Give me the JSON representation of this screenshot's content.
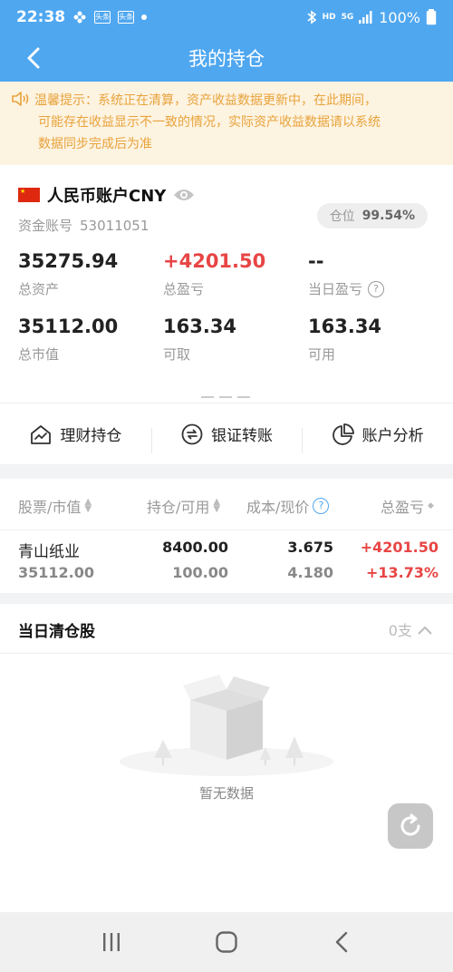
{
  "status": {
    "time": "22:38",
    "net_label": "HD",
    "signal_label": "5G",
    "battery": "100%",
    "chip1": "头条",
    "chip2": "头条"
  },
  "nav": {
    "title": "我的持仓"
  },
  "notice": {
    "line1": "温馨提示：系统正在清算，资产收益数据更新中，在此期间，",
    "line2": "可能存在收益显示不一致的情况，实际资产收益数据请以系统",
    "line3": "数据同步完成后为准"
  },
  "account": {
    "name": "人民币账户CNY",
    "id_label": "资金账号",
    "id_value": "53011051",
    "position_label": "仓位",
    "position_value": "99.54%",
    "total_assets": "35275.94",
    "total_assets_label": "总资产",
    "total_pnl": "+4201.50",
    "total_pnl_label": "总盈亏",
    "day_pnl": "--",
    "day_pnl_label": "当日盈亏",
    "market_value": "35112.00",
    "market_value_label": "总市值",
    "withdrawable": "163.34",
    "withdrawable_label": "可取",
    "available": "163.34",
    "available_label": "可用"
  },
  "actions": [
    {
      "label": "理财持仓"
    },
    {
      "label": "银证转账"
    },
    {
      "label": "账户分析"
    }
  ],
  "table": {
    "headers": [
      "股票/市值",
      "持仓/可用",
      "成本/现价",
      "总盈亏"
    ],
    "rows": [
      {
        "name": "青山纸业",
        "market_value": "35112.00",
        "holding": "8400.00",
        "available": "100.00",
        "cost": "3.675",
        "price": "4.180",
        "pnl": "+4201.50",
        "pnl_pct": "+13.73%"
      }
    ]
  },
  "clear": {
    "title": "当日清仓股",
    "count": "0支",
    "empty_text": "暂无数据"
  },
  "colors": {
    "primary": "#4fa7f0",
    "loss_gain_red": "#e84545",
    "notice_text": "#e8a33c"
  }
}
